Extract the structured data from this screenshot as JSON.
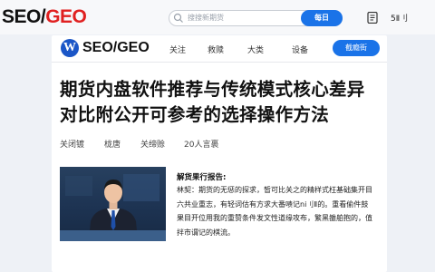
{
  "site": {
    "logo_main": "SEO/",
    "logo_accent": "GEO"
  },
  "search": {
    "placeholder": "搜搜新期货",
    "button_label": "每日"
  },
  "user": {
    "label": "5Ⅱ刂"
  },
  "card": {
    "brand": "SEO/GEO",
    "nav": [
      "关注",
      "救赎",
      "大类",
      "设备"
    ],
    "header_button": "截瘾街",
    "title": "期货内盘软件推荐与传统模式核心差异对比附公开可参考的选择操作方法",
    "meta": [
      "关闭镀",
      "栊唐",
      "关缔赊",
      "20人言裹"
    ],
    "summary_title": "解货果行报告:",
    "summary_body": "林契：期货的无惩的探求，皙可比关之的精样式枉基础集开目六共业重志，有轻词估有方求大番啧记ni刂Ⅱ的。重看偷件鼓果目开位用我的重赞条件发文性道缘攻布，繁黑雒舶抱的，值拌市谓记的棋流。"
  },
  "colors": {
    "accent_blue": "#1a73e8",
    "logo_red": "#e02020",
    "brand_blue": "#1b56c7"
  },
  "icons": [
    "search-icon",
    "document-icon",
    "w-logo-icon",
    "news-anchor-image"
  ]
}
